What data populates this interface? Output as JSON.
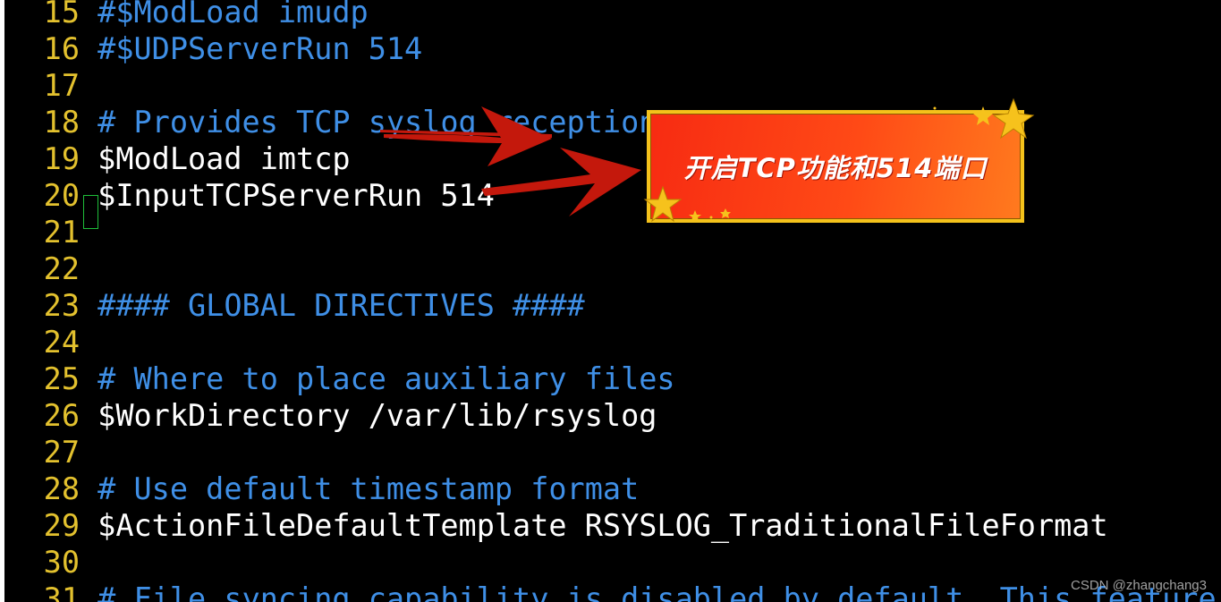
{
  "editor": {
    "lines": [
      {
        "num": "15",
        "text": "#$ModLoad imudp",
        "kind": "comment"
      },
      {
        "num": "16",
        "text": "#$UDPServerRun 514",
        "kind": "comment"
      },
      {
        "num": "17",
        "text": "",
        "kind": "plain"
      },
      {
        "num": "18",
        "text": "# Provides TCP syslog reception",
        "kind": "comment"
      },
      {
        "num": "19",
        "text": "$ModLoad imtcp",
        "kind": "plain"
      },
      {
        "num": "20",
        "text": "$InputTCPServerRun 514",
        "kind": "plain"
      },
      {
        "num": "21",
        "text": "",
        "kind": "plain"
      },
      {
        "num": "22",
        "text": "",
        "kind": "plain"
      },
      {
        "num": "23",
        "text": "#### GLOBAL DIRECTIVES ####",
        "kind": "comment"
      },
      {
        "num": "24",
        "text": "",
        "kind": "plain"
      },
      {
        "num": "25",
        "text": "# Where to place auxiliary files",
        "kind": "comment"
      },
      {
        "num": "26",
        "text": "$WorkDirectory /var/lib/rsyslog",
        "kind": "plain"
      },
      {
        "num": "27",
        "text": "",
        "kind": "plain"
      },
      {
        "num": "28",
        "text": "# Use default timestamp format",
        "kind": "comment"
      },
      {
        "num": "29",
        "text": "$ActionFileDefaultTemplate RSYSLOG_TraditionalFileFormat",
        "kind": "plain"
      },
      {
        "num": "30",
        "text": "",
        "kind": "plain"
      },
      {
        "num": "31",
        "text": "# File syncing capability is disabled by default. This feature i",
        "kind": "comment"
      }
    ]
  },
  "annotation": {
    "banner_text": "开启TCP功能和514端口",
    "arrow_color": "#c4180c",
    "banner_color": "#f72b12",
    "border_color": "#f4c21b"
  },
  "watermark": "CSDN @zhangchang3",
  "colors": {
    "background": "#000000",
    "line_number": "#e3c12e",
    "comment": "#3f8fe6",
    "plain": "#ffffff",
    "cursor": "#1fbf3a"
  }
}
